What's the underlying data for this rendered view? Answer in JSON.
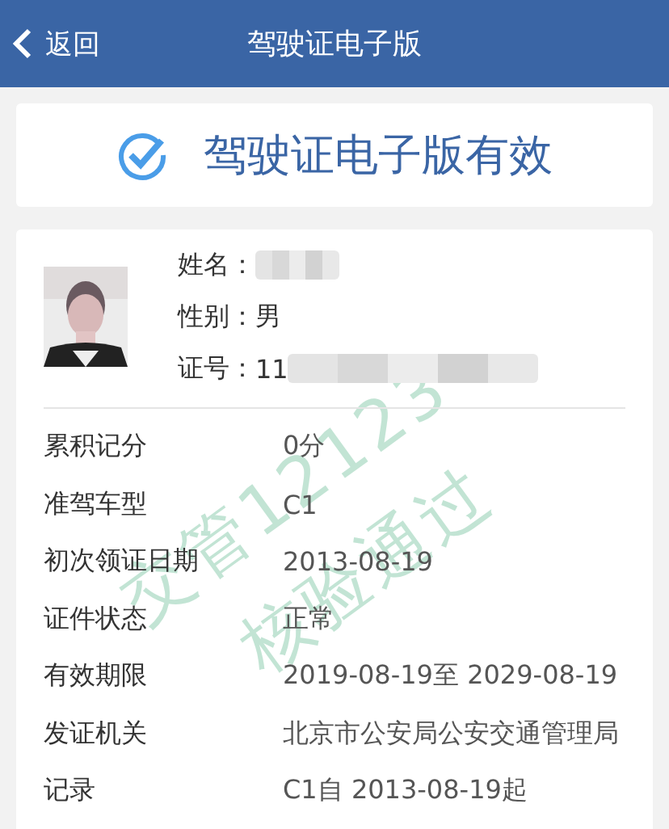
{
  "header": {
    "back": "返回",
    "title": "驾驶证电子版"
  },
  "status": {
    "valid": true,
    "text": "驾驶证电子版有效"
  },
  "holder": {
    "fields": [
      {
        "label": "姓名：",
        "redacted": true
      },
      {
        "label": "性别：",
        "value": "男",
        "redacted": false
      },
      {
        "label": "证号：",
        "value": "11",
        "redacted": true
      }
    ]
  },
  "details": [
    {
      "label": "累积记分",
      "value": "0分"
    },
    {
      "label": "准驾车型",
      "value": "C1"
    },
    {
      "label": "初次领证日期",
      "value": "2013-08-19"
    },
    {
      "label": "证件状态",
      "value": "正常"
    },
    {
      "label": "有效期限",
      "value": "2019-08-19至 2029-08-19"
    },
    {
      "label": "发证机关",
      "value": "北京市公安局公安交通管理局"
    },
    {
      "label": "记录",
      "value": "C1自 2013-08-19起"
    }
  ],
  "watermark": {
    "lines": [
      "交管12123",
      "核验通过"
    ]
  }
}
